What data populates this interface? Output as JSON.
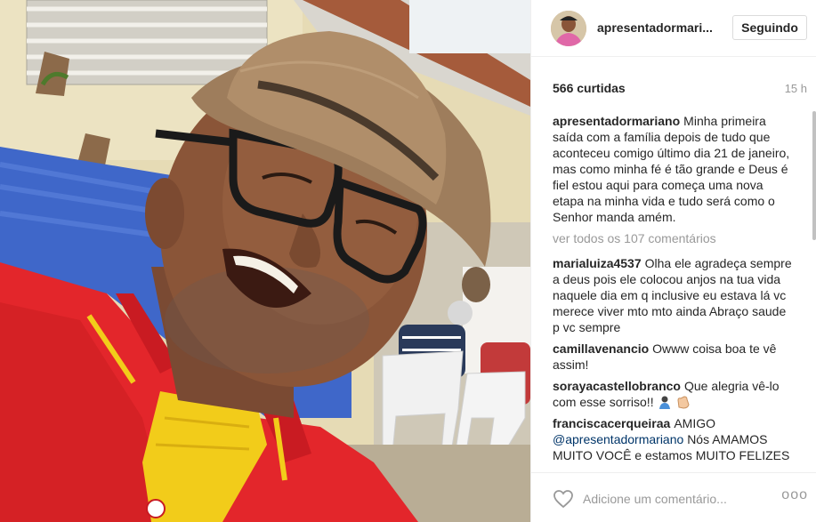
{
  "post": {
    "username": "apresentadormari...",
    "follow_label": "Seguindo",
    "likes": "566 curtidas",
    "time": "15 h",
    "caption": {
      "user": "apresentadormariano",
      "text": "Minha primeira saída com a família depois de tudo que aconteceu comigo último dia 21 de janeiro, mas como minha fé é tão grande e Deus é fiel estou aqui para começa uma nova etapa na minha vida e tudo será como o Senhor manda amém."
    },
    "view_all": "ver todos os 107 comentários",
    "comments": [
      {
        "user": "marialuiza4537",
        "text": "Olha ele agradeça sempre a deus pois ele colocou anjos na tua vida naquele dia em q inclusive eu estava lá vc merece viver mto mto ainda Abraço saude p vc sempre"
      },
      {
        "user": "camillavenancio",
        "text": "Owww coisa boa te vê assim!"
      },
      {
        "user": "sorayacastellobranco",
        "text": "Que alegria vê-lo com esse sorriso!!"
      },
      {
        "user": "franciscacerqueiraa",
        "text": "AMIGO",
        "mention": "@apresentadormariano",
        "rest": "Nós AMAMOS MUITO VOCÊ e estamos MUITO FELIZES"
      }
    ],
    "add_comment_placeholder": "Adicione um comentário...",
    "more_label": "ooo"
  },
  "icons": {
    "heart": "heart-icon",
    "more": "more-options-icon",
    "emoji_person": "person-emoji-icon",
    "emoji_hands": "clapping-hands-emoji-icon"
  },
  "colors": {
    "username": "#262626",
    "mention": "#003569",
    "muted": "#999999",
    "border": "#dbdbdb"
  }
}
